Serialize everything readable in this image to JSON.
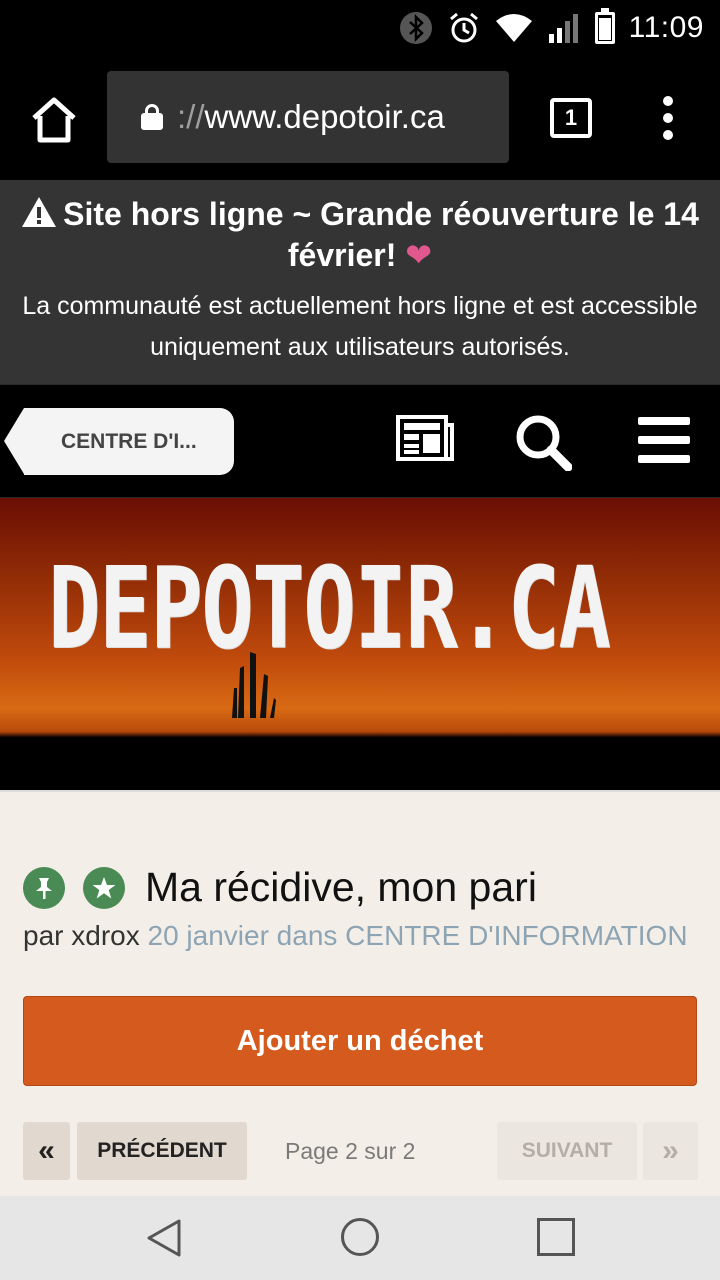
{
  "status_bar": {
    "time": "11:09",
    "battery_level": 0.85,
    "icons": [
      "bluetooth-icon",
      "alarm-icon",
      "wifi-icon",
      "signal-icon",
      "battery-icon"
    ]
  },
  "browser": {
    "url_scheme": "://",
    "url_host": "www.depotoir.ca",
    "tab_count": "1"
  },
  "notice": {
    "title": "Site hors ligne ~ Grande réouverture le 14 février!",
    "heart": "❤",
    "text": "La communauté est actuellement hors ligne et est accessible uniquement aux utilisateurs autorisés."
  },
  "site_nav": {
    "breadcrumb": "CENTRE D'I..."
  },
  "banner": {
    "logo": "DEPOTOIR.CA"
  },
  "topic": {
    "title": "Ma récidive, mon pari",
    "author_prefix": "par xdrox",
    "date_forum": "20 janvier dans CENTRE D'INFORMATION",
    "reply_button": "Ajouter un déchet"
  },
  "pagination": {
    "first": "«",
    "prev": "PRÉCÉDENT",
    "info": "Page 2 sur 2",
    "next": "SUIVANT",
    "last": "»"
  },
  "colors": {
    "notice_bg": "#343434",
    "accent_orange": "#d55a1d",
    "badge_green": "#4a8a55",
    "content_bg": "#f3efe8"
  }
}
